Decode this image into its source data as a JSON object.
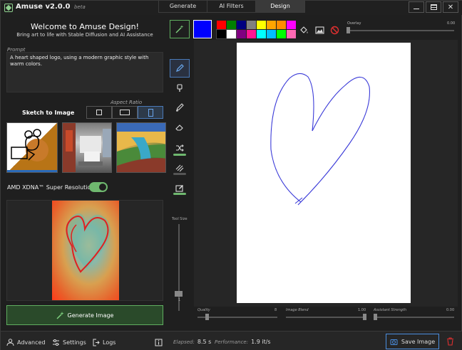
{
  "app": {
    "title": "Amuse",
    "version": "v2.0.0",
    "version_tag": "beta"
  },
  "tabs": [
    {
      "label": "Generate"
    },
    {
      "label": "AI Filters"
    },
    {
      "label": "Design"
    }
  ],
  "left": {
    "welcome": "Welcome to Amuse Design!",
    "tagline": "Bring art to life with Stable Diffusion and AI Assistance",
    "prompt_label": "Prompt",
    "prompt_value": "A heart shaped logo, using a modern graphic style with warm colors.",
    "aspect_label": "Aspect Ratio",
    "sketch_title": "Sketch to Image",
    "xdna_label": "AMD XDNA™ Super Resolution",
    "xdna_on": true,
    "generate_label": "Generate Image"
  },
  "toolbar": {
    "main_color": "#0000ff",
    "palette": [
      "#ff0000",
      "#008000",
      "#000080",
      "#808080",
      "#ffff00",
      "#ffa500",
      "#ff8c00",
      "#ff00ff",
      "#000000",
      "#ffffff",
      "#800080",
      "#ff1493",
      "#00ffff",
      "#00bfff",
      "#00ff00",
      "#ff69b4"
    ],
    "overlay_label": "Overlay",
    "overlay_value": "0.00",
    "tool_size_label": "Tool Size",
    "tool_size_value": "1"
  },
  "sliders": {
    "quality_label": "Quality",
    "quality_value": "8",
    "blend_label": "Image Blend",
    "blend_value": "1.00",
    "assist_label": "Assistant Strength",
    "assist_value": "0.00"
  },
  "status": {
    "advanced": "Advanced",
    "settings": "Settings",
    "logs": "Logs",
    "elapsed_label": "Elapsed:",
    "elapsed_value": "8.5 s",
    "perf_label": "Performance:",
    "perf_value": "1.9 it/s",
    "save_label": "Save Image"
  }
}
